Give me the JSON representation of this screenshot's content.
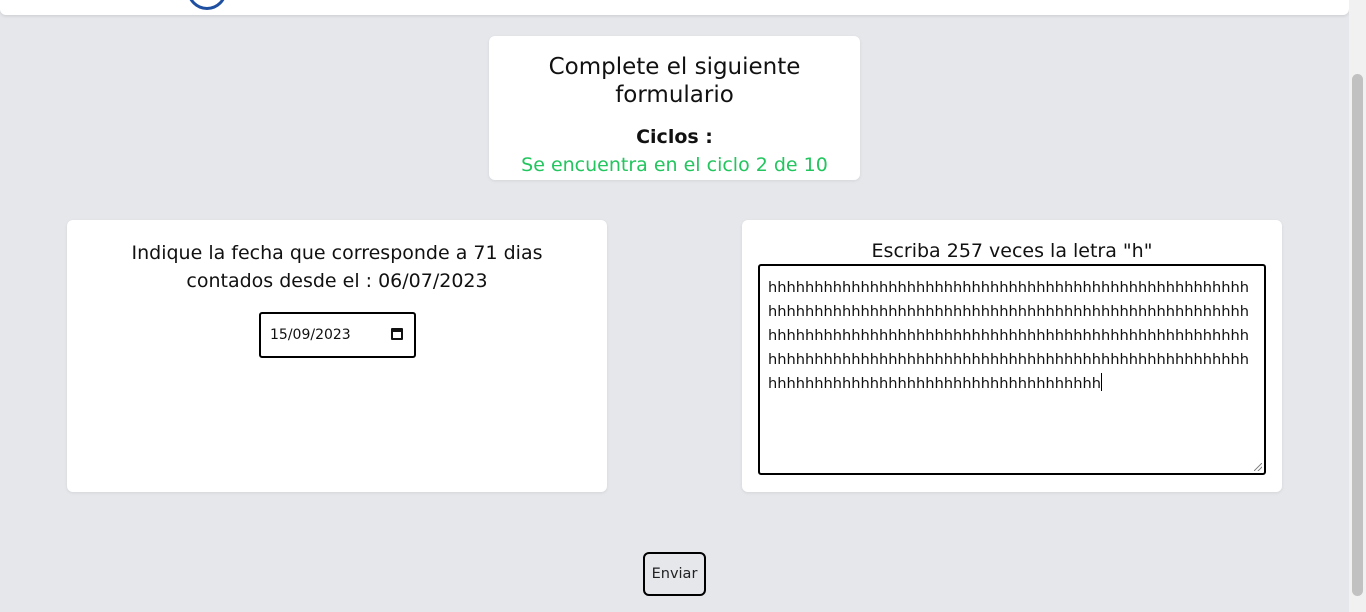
{
  "header": {
    "logo_icon": "circle-logo-icon"
  },
  "title_card": {
    "title": "Complete el siguiente formulario",
    "cycles_label": "Ciclos :",
    "cycles_status": "Se encuentra en el ciclo 2 de 10",
    "status_color": "#22c55e"
  },
  "date_question": {
    "text": "Indique la fecha que corresponde a 71 dias contados desde el : 06/07/2023",
    "date_value": "15/09/2023",
    "icon": "calendar-icon"
  },
  "text_question": {
    "instruction": "Escriba 257 veces la letra \"h\"",
    "answer": "hhhhhhhhhhhhhhhhhhhhhhhhhhhhhhhhhhhhhhhhhhhhhhhhhhhhhhhhhhhhhhhhhhhhhhhhhhhhhhhhhhhhhhhhhhhhhhhhhhhhhhhhhhhhhhhhhhhhhhhhhhhhhhhhhhhhhhhhhhhhhhhhhhhhhhhhhhhhhhhhhhhhhhhhhhhhhhhhhhhhhhhhhhhhhhhhhhhhhhhhhhhhhhhhhhhhhhhhhhhhhhhhhhhhhhhhhhhhhhhhhhhh"
  },
  "actions": {
    "submit_label": "Enviar"
  }
}
